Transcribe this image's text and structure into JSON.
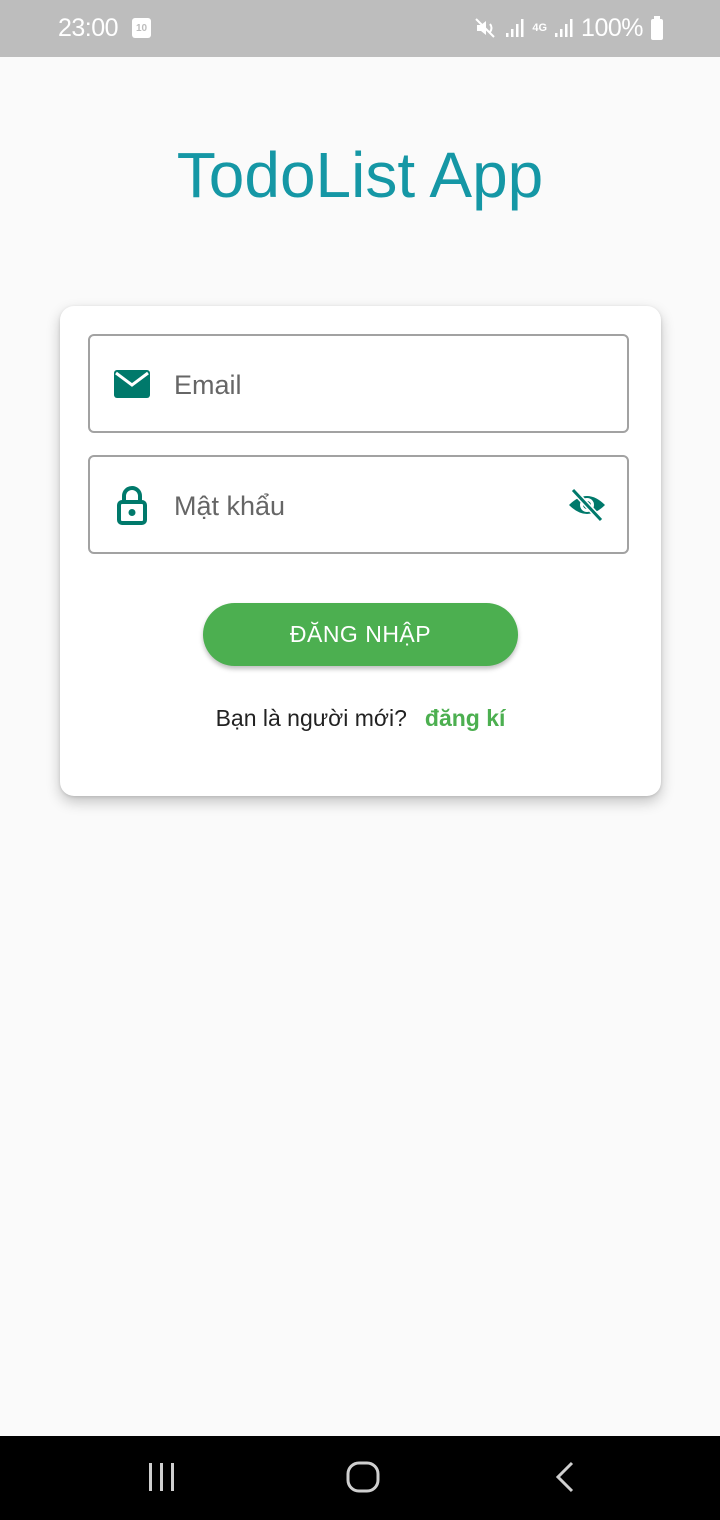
{
  "status_bar": {
    "time": "23:00",
    "calendar_day": "10",
    "network_type": "4G",
    "battery": "100%"
  },
  "app": {
    "title": "TodoList App"
  },
  "login_form": {
    "email_placeholder": "Email",
    "password_placeholder": "Mật khẩu",
    "login_button": "ĐĂNG NHẬP",
    "new_user_prompt": "Bạn là người mới?",
    "register_link": "đăng kí"
  },
  "colors": {
    "title": "#1597a5",
    "icon": "#00796b",
    "primary_button": "#4caf50",
    "status_bar": "#bdbdbd"
  },
  "icons": {
    "email": "mail-icon",
    "password": "lock-icon",
    "visibility": "eye-off-icon"
  }
}
